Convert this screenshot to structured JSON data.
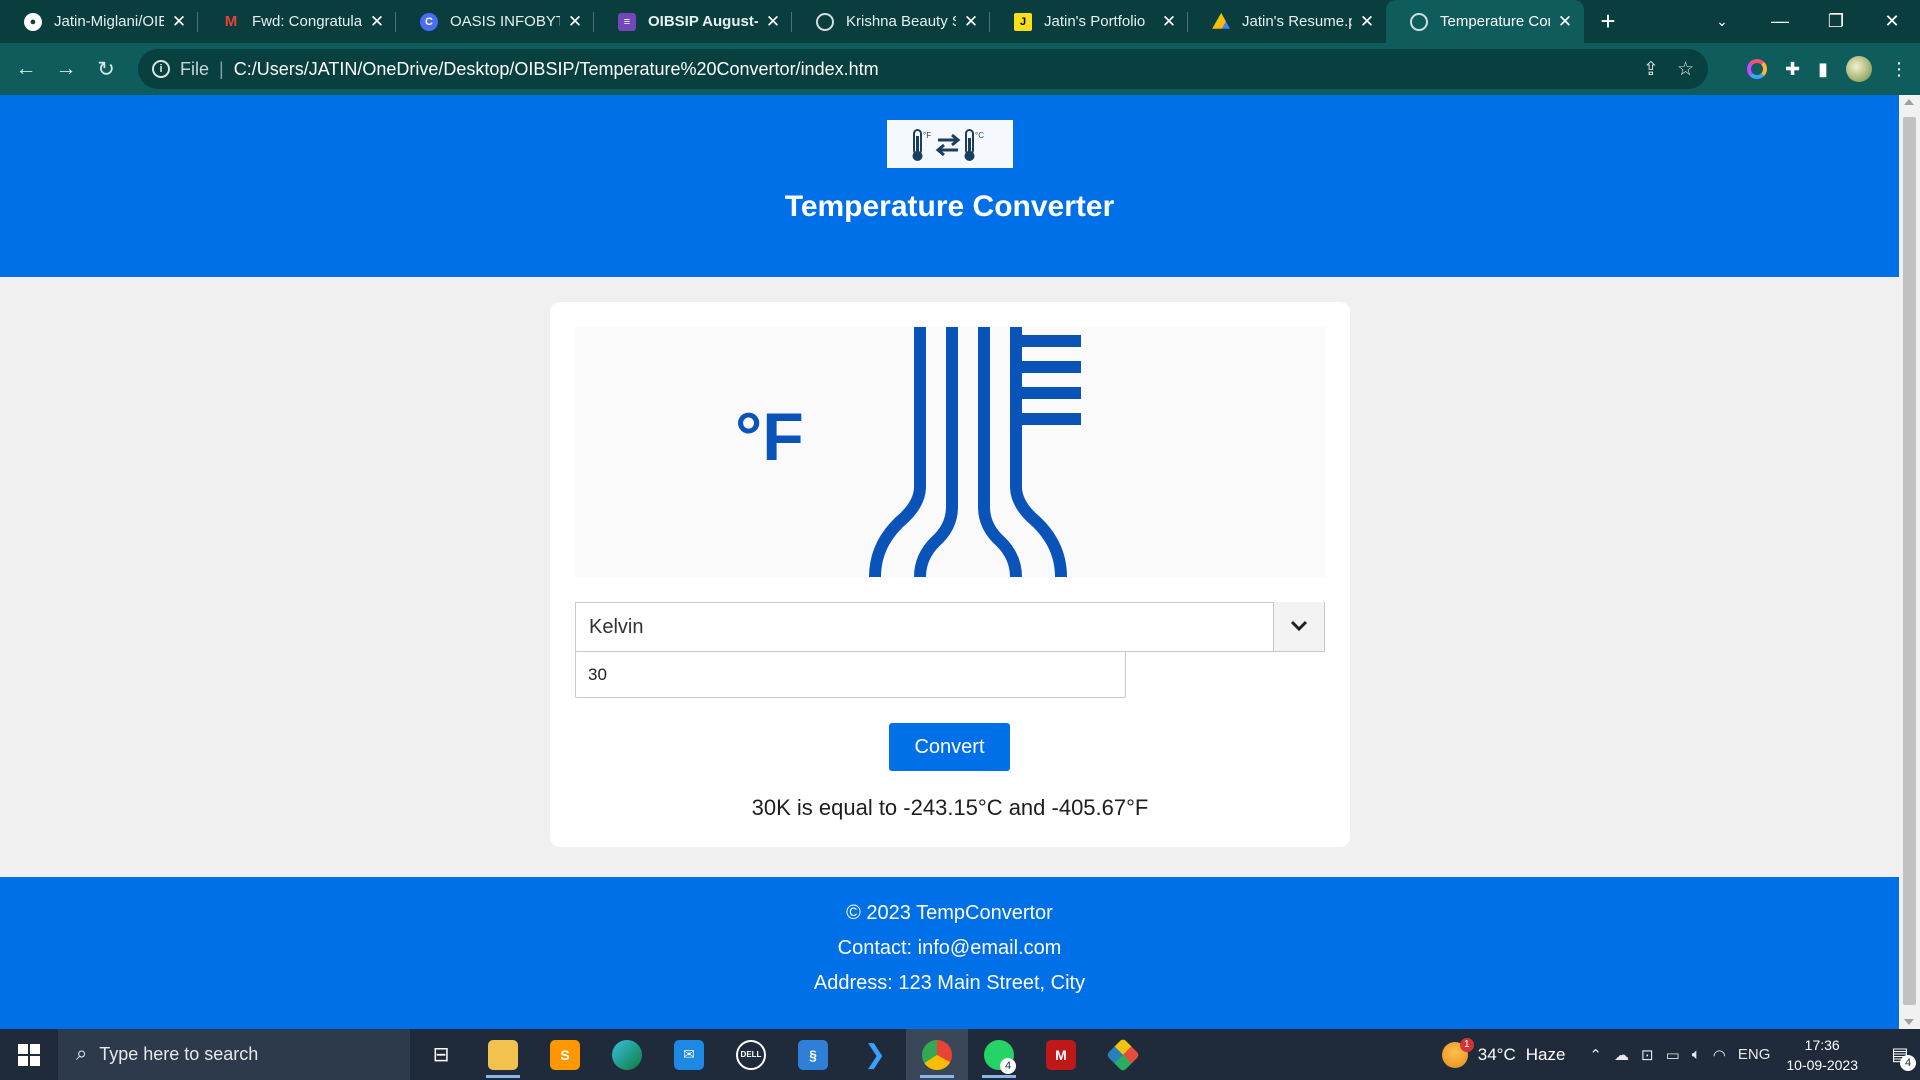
{
  "browser": {
    "tabs": [
      {
        "title": "Jatin-Miglani/OIB",
        "favicon": "github-icon",
        "active": false
      },
      {
        "title": "Fwd: Congratulati",
        "favicon": "gmail-icon",
        "active": false
      },
      {
        "title": "OASIS INFOBYTE",
        "favicon": "canva-icon",
        "active": false
      },
      {
        "title": "OIBSIP August- P",
        "favicon": "forms-icon",
        "active": false
      },
      {
        "title": "Krishna Beauty Sa",
        "favicon": "globe-icon",
        "active": false
      },
      {
        "title": "Jatin's Portfolio",
        "favicon": "js-icon",
        "active": false
      },
      {
        "title": "Jatin's Resume.pd",
        "favicon": "drive-icon",
        "active": false
      },
      {
        "title": "Temperature Con",
        "favicon": "globe-icon",
        "active": true
      }
    ],
    "address": {
      "scheme": "File",
      "url": "C:/Users/JATIN/OneDrive/Desktop/OIBSIP/Temperature%20Convertor/index.htm"
    }
  },
  "page": {
    "title": "Temperature Converter",
    "logo": {
      "left_unit": "°F",
      "right_unit": "°C"
    },
    "hero_unit": "°F",
    "unit_select": {
      "selected": "Kelvin"
    },
    "temperature_input": {
      "value": "30"
    },
    "convert_label": "Convert",
    "result": "30K is equal to -243.15°C and -405.67°F",
    "footer": {
      "copyright": "© 2023 TempConvertor",
      "contact": "Contact: info@email.com",
      "address": "Address: 123 Main Street, City"
    }
  },
  "taskbar": {
    "search_placeholder": "Type here to search",
    "weather": {
      "temp": "34°C",
      "condition": "Haze",
      "alert_count": "1"
    },
    "language": "ENG",
    "time": "17:36",
    "date": "10-09-2023",
    "whatsapp_badge": "4",
    "notifications_badge": "4"
  },
  "colors": {
    "chrome_dark": "#0a3d3d",
    "chrome_toolbar": "#0e5c5c",
    "brand_blue": "#0070e8",
    "hero_blue": "#0a53b8",
    "taskbar": "#1f2b3a"
  }
}
